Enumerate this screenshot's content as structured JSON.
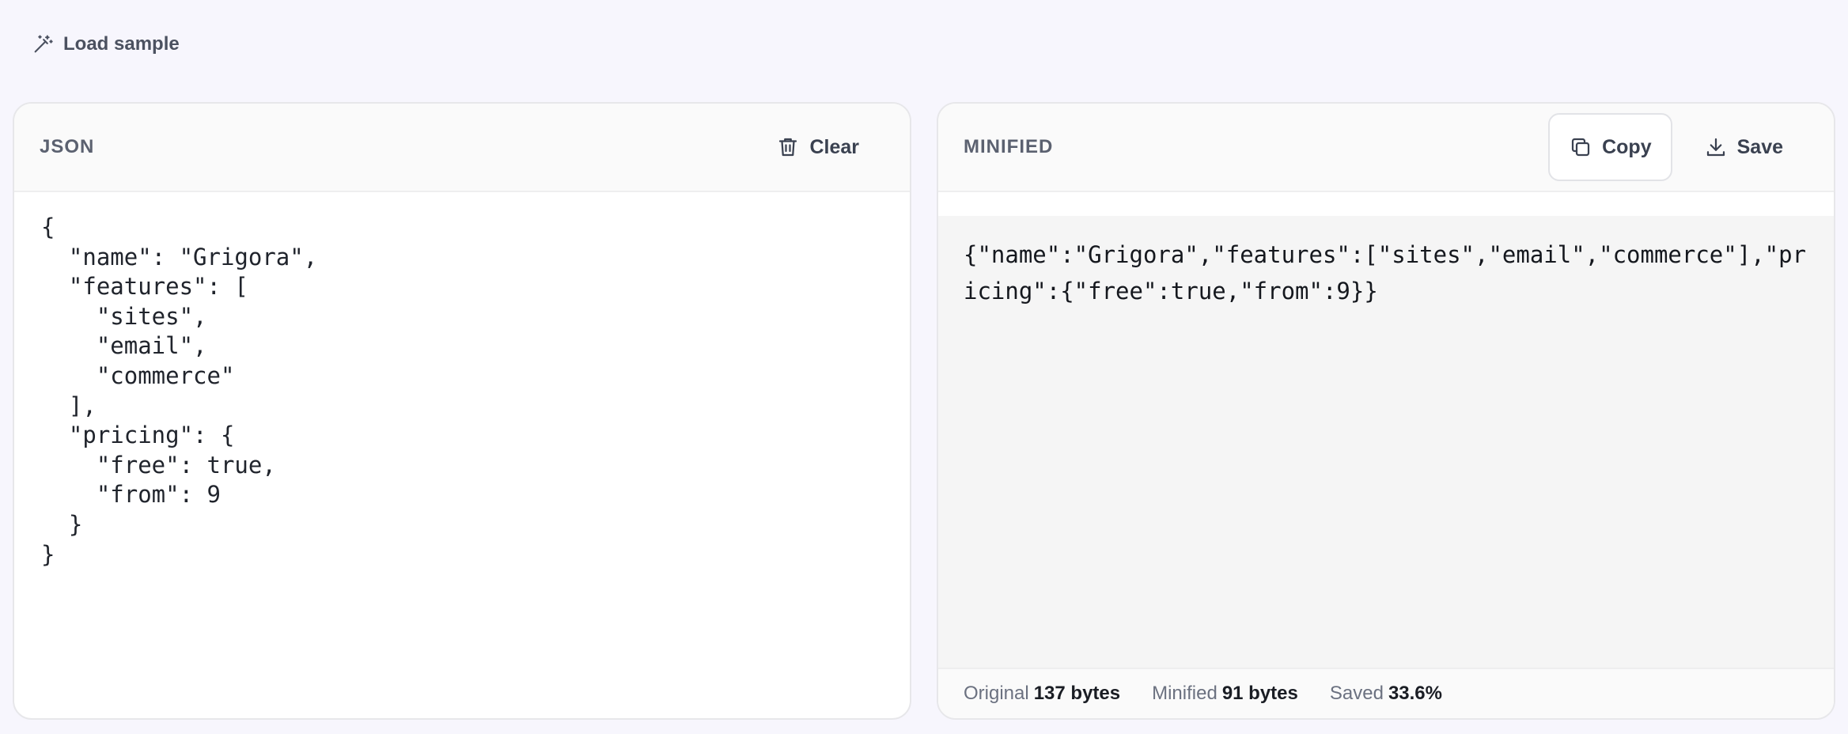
{
  "toolbar": {
    "load_sample_label": "Load sample",
    "load_sample_icon": "magic-wand-icon"
  },
  "input_panel": {
    "title": "JSON",
    "clear_label": "Clear",
    "clear_icon": "trash-icon",
    "content": "{\n  \"name\": \"Grigora\",\n  \"features\": [\n    \"sites\",\n    \"email\",\n    \"commerce\"\n  ],\n  \"pricing\": {\n    \"free\": true,\n    \"from\": 9\n  }\n}"
  },
  "output_panel": {
    "title": "MINIFIED",
    "copy_label": "Copy",
    "copy_icon": "copy-icon",
    "save_label": "Save",
    "save_icon": "download-icon",
    "content": "{\"name\":\"Grigora\",\"features\":[\"sites\",\"email\",\"commerce\"],\"pricing\":{\"free\":true,\"from\":9}}"
  },
  "stats": {
    "original_label": "Original",
    "original_value": "137 bytes",
    "minified_label": "Minified",
    "minified_value": "91 bytes",
    "saved_label": "Saved",
    "saved_value": "33.6%"
  },
  "colors": {
    "page_background": "#f7f6fd",
    "panel_header": "#fafafa",
    "output_background": "#f5f5f5",
    "text_muted": "#5b6170"
  }
}
